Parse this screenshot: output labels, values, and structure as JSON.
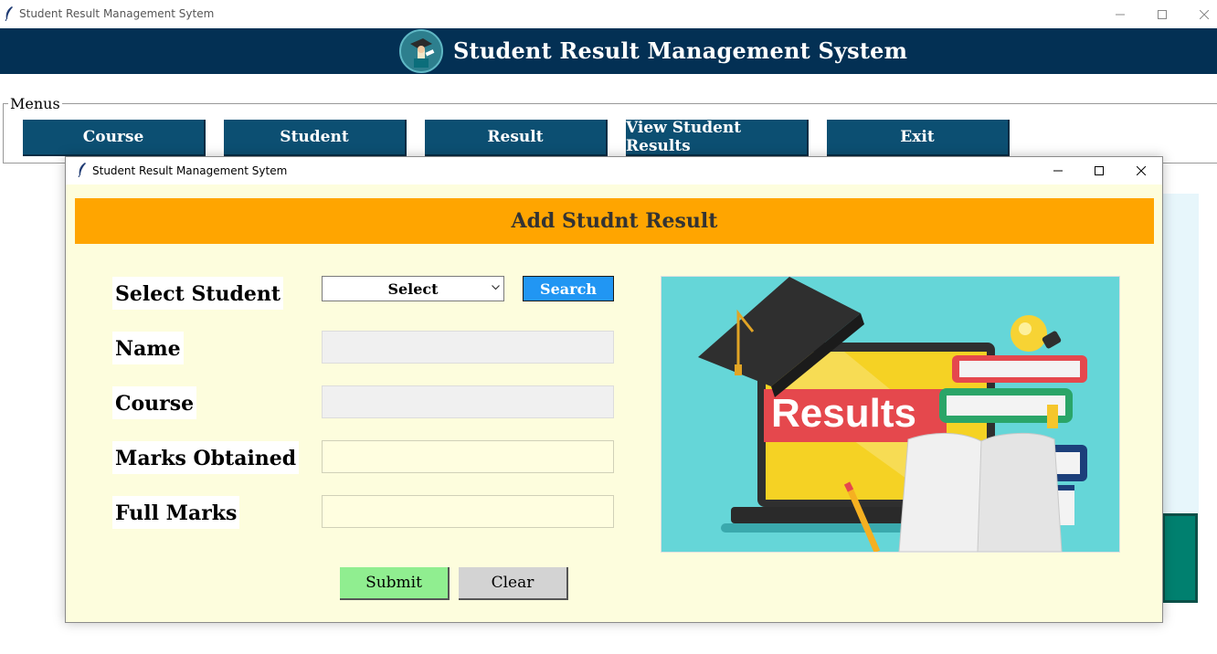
{
  "window": {
    "title": "Student Result Management Sytem"
  },
  "header": {
    "title": "Student Result Management System"
  },
  "menus": {
    "legend": "Menus",
    "buttons": [
      "Course",
      "Student",
      "Result",
      "View Student Results",
      "Exit"
    ]
  },
  "dialog": {
    "title": "Student Result Management Sytem",
    "banner": "Add Studnt Result",
    "labels": {
      "select_student": "Select Student",
      "name": "Name",
      "course": "Course",
      "marks_obtained": "Marks Obtained",
      "full_marks": "Full Marks"
    },
    "select_value": "Select",
    "search_label": "Search",
    "fields": {
      "name": "",
      "course": "",
      "marks_obtained": "",
      "full_marks": ""
    },
    "submit_label": "Submit",
    "clear_label": "Clear",
    "illustration_text": "Results"
  },
  "colors": {
    "header_bg": "#033054",
    "menu_button_bg": "#0c4f72",
    "banner_bg": "#ffa500",
    "dialog_bg": "#fdfddd",
    "search_bg": "#2196f3",
    "submit_bg": "#90ee90",
    "clear_bg": "#d3d3d3"
  },
  "icons": {
    "app": "feather-icon",
    "logo": "graduate-logo-icon",
    "minimize": "minimize-icon",
    "maximize": "maximize-icon",
    "close": "close-icon",
    "dropdown": "chevron-down-icon"
  }
}
